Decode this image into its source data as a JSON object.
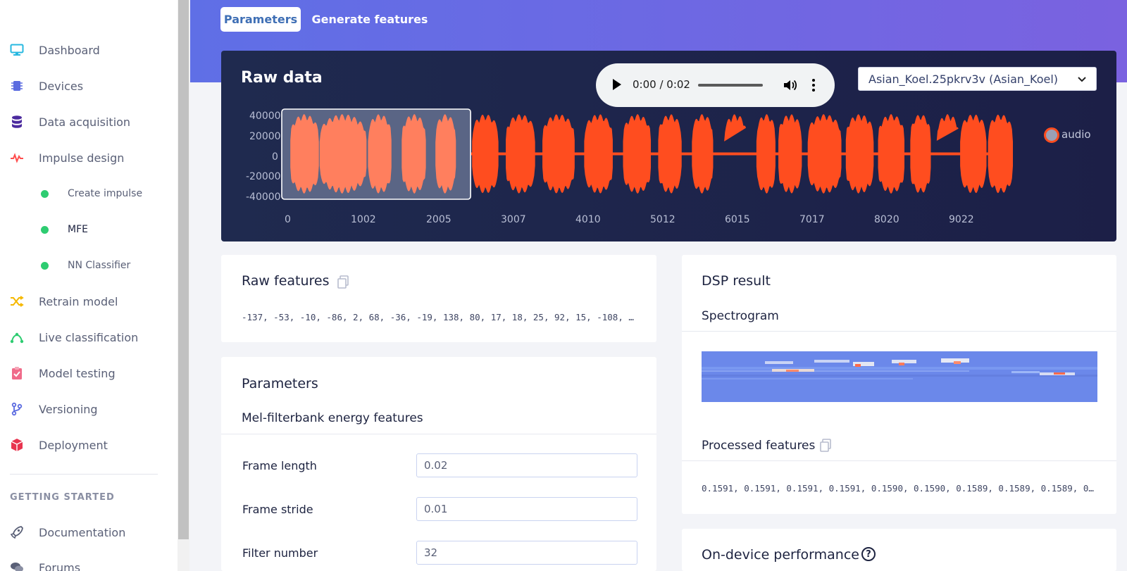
{
  "sidebar": {
    "items": [
      {
        "label": "Dashboard",
        "icon": "monitor-icon",
        "color": "#27b8e0"
      },
      {
        "label": "Devices",
        "icon": "chip-icon",
        "color": "#5b6be0"
      },
      {
        "label": "Data acquisition",
        "icon": "database-icon",
        "color": "#4b2a9e"
      },
      {
        "label": "Impulse design",
        "icon": "pulse-icon",
        "color": "#ff4d4d"
      },
      {
        "label": "Retrain model",
        "icon": "shuffle-icon",
        "color": "#f5b800"
      },
      {
        "label": "Live classification",
        "icon": "nodes-icon",
        "color": "#2ecc71"
      },
      {
        "label": "Model testing",
        "icon": "clipboard-check-icon",
        "color": "#f06b8a"
      },
      {
        "label": "Versioning",
        "icon": "git-branch-icon",
        "color": "#5b6be0"
      },
      {
        "label": "Deployment",
        "icon": "package-icon",
        "color": "#e8344f"
      }
    ],
    "subitems": [
      {
        "label": "Create impulse",
        "active": false
      },
      {
        "label": "MFE",
        "active": true
      },
      {
        "label": "NN Classifier",
        "active": false
      }
    ],
    "getting_started_heading": "GETTING STARTED",
    "getting_started": [
      {
        "label": "Documentation",
        "icon": "rocket-icon"
      },
      {
        "label": "Forums",
        "icon": "chat-icon"
      }
    ]
  },
  "tabs": {
    "parameters": "Parameters",
    "generate": "Generate features"
  },
  "raw_data": {
    "title": "Raw data",
    "player": {
      "time": "0:00 / 0:02"
    },
    "sample_select": "Asian_Koel.25pkrv3v (Asian_Koel)",
    "legend": "audio",
    "wave_color": "#ff4d1f",
    "highlight_color": "#ff7f5e"
  },
  "chart_data": {
    "type": "line",
    "series": [
      {
        "name": "audio"
      }
    ],
    "yticks": [
      "40000",
      "20000",
      "0",
      "-20000",
      "-40000"
    ],
    "xticks": [
      "0",
      "1002",
      "2005",
      "3007",
      "4010",
      "5012",
      "6015",
      "7017",
      "8020",
      "9022"
    ],
    "ylim": [
      -40000,
      40000
    ],
    "window_ms": [
      0,
      2500
    ],
    "legend_position": "right",
    "bursts_ms": [
      [
        40,
        430
      ],
      [
        440,
        1080
      ],
      [
        1100,
        1420
      ],
      [
        1560,
        1890
      ],
      [
        2020,
        2300
      ],
      [
        2520,
        2880
      ],
      [
        2980,
        3380
      ],
      [
        3480,
        3920
      ],
      [
        4050,
        4440
      ],
      [
        4580,
        4960
      ],
      [
        5060,
        5380
      ],
      [
        5520,
        5810
      ],
      [
        5960,
        6270
      ]
    ],
    "segments_ms": [
      [
        6400,
        6660
      ],
      [
        6700,
        7020
      ],
      [
        7100,
        7560
      ],
      [
        7620,
        8000
      ],
      [
        8060,
        8420
      ],
      [
        8500,
        8780
      ],
      [
        8860,
        9170
      ],
      [
        9180,
        9540
      ],
      [
        9560,
        9900
      ]
    ],
    "peak_amplitude": 40000
  },
  "raw_features": {
    "title": "Raw features",
    "values": "-137, -53, -10, -86, 2, 68, -36, -19, 138, 80, 17, 18, 25, 92, 15, -108, -…"
  },
  "parameters": {
    "title": "Parameters",
    "subtitle": "Mel-filterbank energy features",
    "fields": [
      {
        "label": "Frame length",
        "value": "0.02"
      },
      {
        "label": "Frame stride",
        "value": "0.01"
      },
      {
        "label": "Filter number",
        "value": "32"
      }
    ]
  },
  "dsp": {
    "title": "DSP result",
    "spectrogram_label": "Spectrogram",
    "processed_label": "Processed features",
    "processed_values": "0.1591, 0.1591, 0.1591, 0.1591, 0.1590, 0.1590, 0.1589, 0.1589, 0.1589, 0.…"
  },
  "performance": {
    "title": "On-device performance"
  }
}
